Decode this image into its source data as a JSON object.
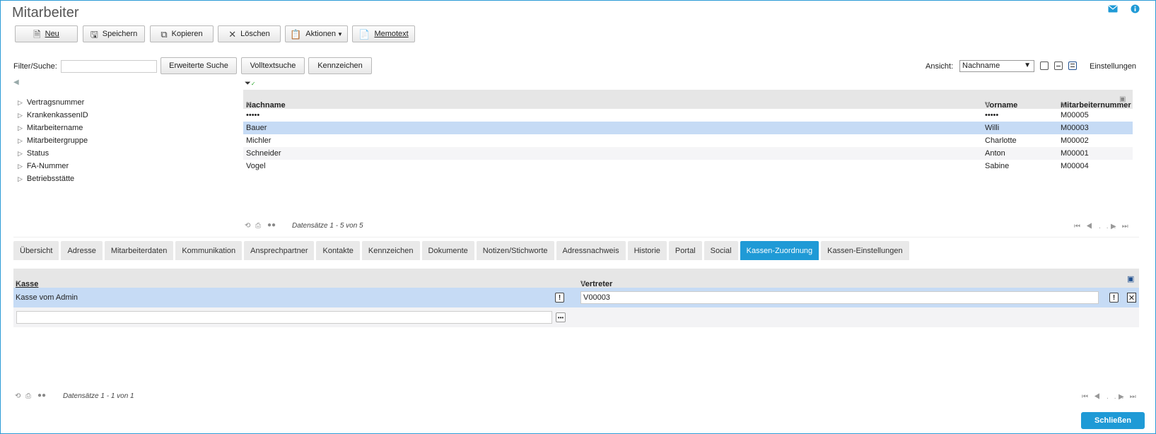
{
  "page": {
    "title": "Mitarbeiter"
  },
  "toolbar": {
    "new_label": "Neu",
    "save_label": "Speichern",
    "copy_label": "Kopieren",
    "delete_label": "Löschen",
    "actions_label": "Aktionen",
    "memo_label": "Memotext"
  },
  "filter": {
    "label": "Filter/Suche:",
    "value": "",
    "advanced_label": "Erweiterte Suche",
    "fulltext_label": "Volltextsuche",
    "tags_label": "Kennzeichen"
  },
  "view": {
    "label": "Ansicht:",
    "selected": "Nachname",
    "settings_label": "Einstellungen"
  },
  "tree": {
    "items": [
      "Vertragsnummer",
      "KrankenkassenID",
      "Mitarbeitername",
      "Mitarbeitergruppe",
      "Status",
      "FA-Nummer",
      "Betriebsstätte"
    ]
  },
  "grid": {
    "columns": [
      "Nachname",
      "Vorname",
      "Mitarbeiternummer"
    ],
    "rows": [
      [
        "•••••",
        "•••••",
        "M00005"
      ],
      [
        "Bauer",
        "Willi",
        "M00003"
      ],
      [
        "Michler",
        "Charlotte",
        "M00002"
      ],
      [
        "Schneider",
        "Anton",
        "M00001"
      ],
      [
        "Vogel",
        "Sabine",
        "M00004"
      ]
    ],
    "status": "Datensätze 1 - 5 von 5"
  },
  "tabs": [
    "Übersicht",
    "Adresse",
    "Mitarbeiterdaten",
    "Kommunikation",
    "Ansprechpartner",
    "Kontakte",
    "Kennzeichen",
    "Dokumente",
    "Notizen/Stichworte",
    "Adressnachweis",
    "Historie",
    "Portal",
    "Social",
    "Kassen-Zuordnung",
    "Kassen-Einstellungen"
  ],
  "active_tab": "Kassen-Zuordnung",
  "subgrid": {
    "columns": [
      "Kasse",
      "Vertreter"
    ],
    "row": {
      "kasse": "Kasse vom Admin",
      "vertreter": "V00003"
    },
    "new_row_value": "",
    "status": "Datensätze 1 - 1 von 1"
  },
  "pager": {
    "ellipsis": "..."
  },
  "footer": {
    "close_label": "Schließen"
  },
  "colors": {
    "accent": "#1f9ad6",
    "selected_row": "#c6dbf5"
  }
}
